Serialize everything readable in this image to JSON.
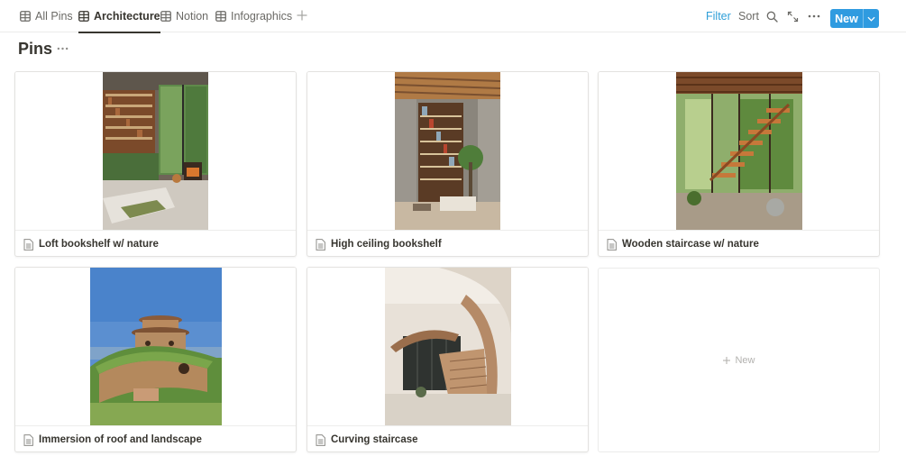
{
  "tabs": [
    {
      "label": "All Pins",
      "icon": "table-grid-icon",
      "active": false
    },
    {
      "label": "Architecture",
      "icon": "table-grid-icon",
      "active": true
    },
    {
      "label": "Notion",
      "icon": "table-grid-icon",
      "active": false
    },
    {
      "label": "Infographics",
      "icon": "table-grid-icon",
      "active": false
    }
  ],
  "add_view_icon": "plus-icon",
  "toolbar": {
    "filter_label": "Filter",
    "sort_label": "Sort",
    "search_icon": "search-icon",
    "expand_icon": "expand-arrows-icon",
    "more_icon": "more-horizontal-icon",
    "new_label": "New",
    "new_caret_icon": "chevron-down-icon"
  },
  "page": {
    "title": "Pins",
    "more_icon": "more-horizontal-icon"
  },
  "cards": [
    {
      "title": "Loft bookshelf w/ nature",
      "icon": "page-icon"
    },
    {
      "title": "High ceiling bookshelf",
      "icon": "page-icon"
    },
    {
      "title": "Wooden staircase w/ nature",
      "icon": "page-icon"
    },
    {
      "title": "Immersion of roof and landscape",
      "icon": "page-icon"
    },
    {
      "title": "Curving staircase",
      "icon": "page-icon"
    }
  ],
  "new_card": {
    "label": "New",
    "icon": "plus-icon"
  },
  "colors": {
    "accent": "#2f9be0",
    "filter_text": "#2e9fd8",
    "text": "#37352f",
    "muted": "#6b6a66"
  }
}
